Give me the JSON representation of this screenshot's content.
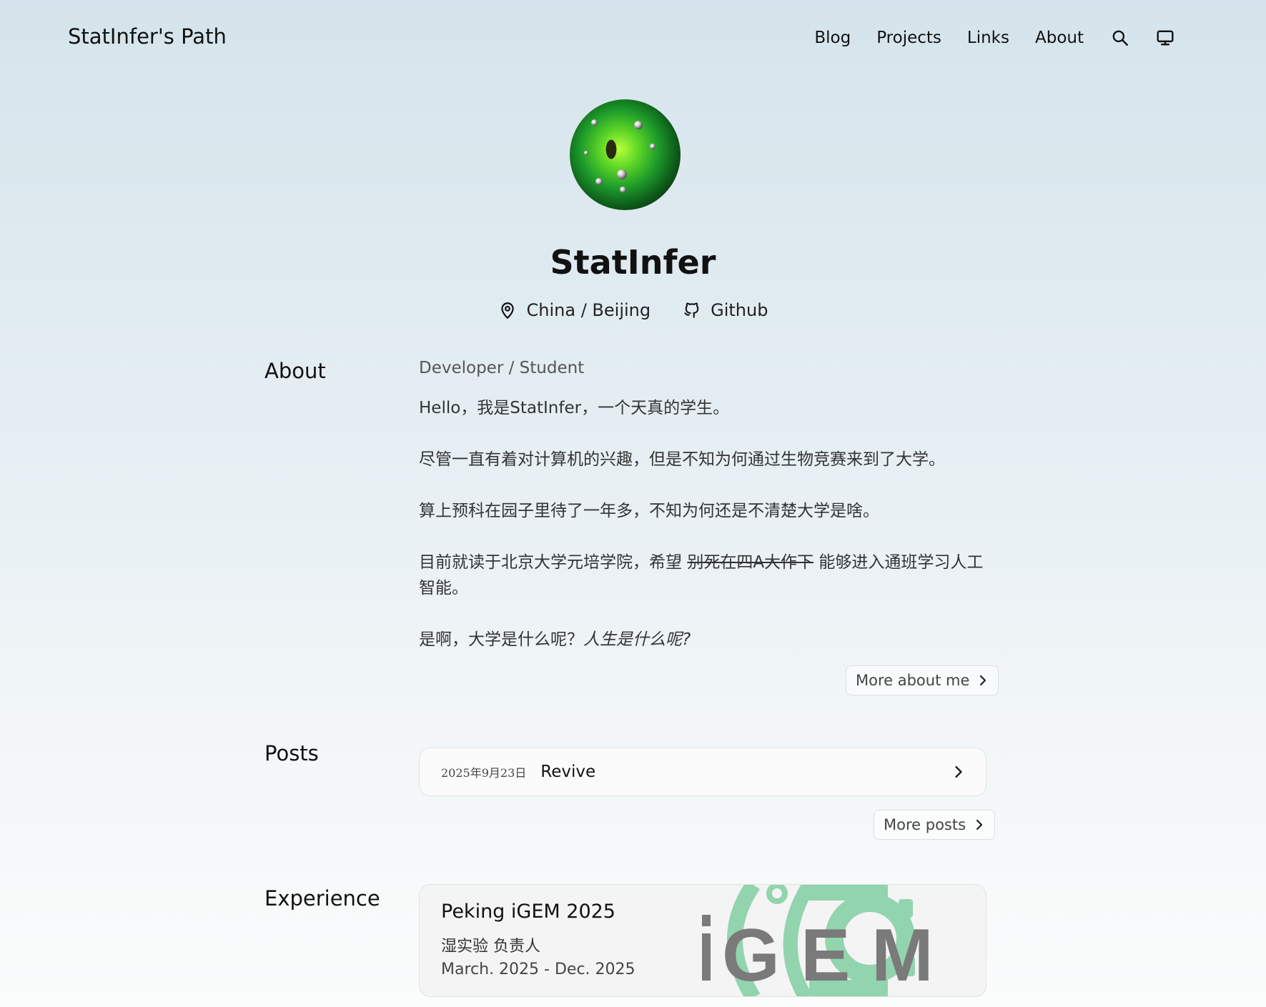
{
  "header": {
    "site_title": "StatInfer's Path",
    "nav": [
      "Blog",
      "Projects",
      "Links",
      "About"
    ]
  },
  "icons": {
    "search": "search-icon",
    "theme": "monitor-icon",
    "location": "map-pin-icon",
    "github": "github-icon",
    "chevron": "chevron-right-icon"
  },
  "profile": {
    "name": "StatInfer",
    "location": "China / Beijing",
    "github_label": "Github"
  },
  "about": {
    "heading": "About",
    "role": "Developer / Student",
    "p1": "Hello，我是StatInfer，一个天真的学生。",
    "p2": "尽管一直有着对计算机的兴趣，但是不知为何通过生物竞赛来到了大学。",
    "p3": "算上预科在园子里待了一年多，不知为何还是不清楚大学是啥。",
    "p4_start": "目前就读于北京大学元培学院，希望 ",
    "p4_strike": "别死在四A大作下",
    "p4_end": " 能够进入通班学习人工智能。",
    "p5_start": "是啊，大学是什么呢？",
    "p5_italic": "人生是什么呢?",
    "more_button": "More about me"
  },
  "posts": {
    "heading": "Posts",
    "items": [
      {
        "date": "2025年9月23日",
        "title": "Revive"
      }
    ],
    "more_button": "More posts"
  },
  "experience": {
    "heading": "Experience",
    "items": [
      {
        "title": "Peking iGEM 2025",
        "role": "湿实验 负责人",
        "dates": "March. 2025 - Dec. 2025",
        "logo_text": "iGEM"
      }
    ]
  },
  "colors": {
    "igem_green": "#92d4ae",
    "igem_gray": "#7a7a7a"
  }
}
